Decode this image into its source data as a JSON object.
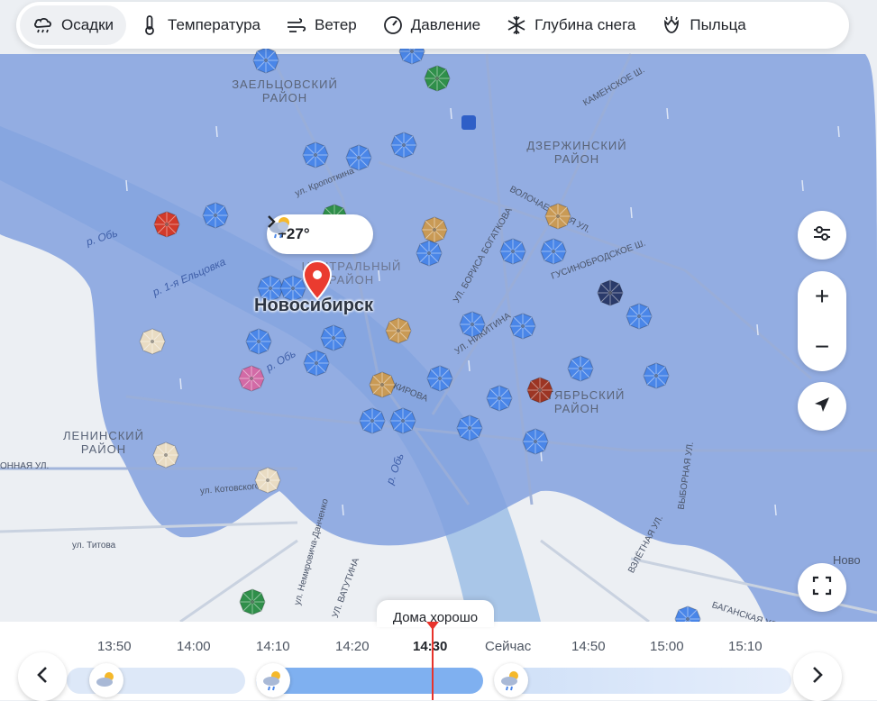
{
  "tabs": [
    {
      "label": "Осадки",
      "icon": "rain-cloud-icon",
      "active": true
    },
    {
      "label": "Температура",
      "icon": "thermometer-icon",
      "active": false
    },
    {
      "label": "Ветер",
      "icon": "wind-icon",
      "active": false
    },
    {
      "label": "Давление",
      "icon": "pressure-gauge-icon",
      "active": false
    },
    {
      "label": "Глубина снега",
      "icon": "snowflake-icon",
      "active": false
    },
    {
      "label": "Пыльца",
      "icon": "pollen-icon",
      "active": false
    }
  ],
  "city": {
    "name": "Новосибирск",
    "temperature": "+27°",
    "weather_icon": "partly-cloudy-rain-icon"
  },
  "map_labels": {
    "districts": [
      "ЗАЕЛЬЦОВСКИЙ\nРАЙОН",
      "ДЗЕРЖИНСКИЙ\nРАЙОН",
      "ЦЕНТРАЛЬНЫЙ\nРАЙОН",
      "ОКТЯБРЬСКИЙ\nРАЙОН",
      "ЛЕНИНСКИЙ\nРАЙОН"
    ],
    "rivers": [
      "р. Обь",
      "р. 1-я Ельцовка",
      "р. Обь",
      "р. Обь"
    ],
    "streets": [
      "ул. Кропоткина",
      "КАМЕНСКОЕ Ш.",
      "ВОЛОЧАЕВСКАЯ УЛ.",
      "ГУСИНОБРОДСКОЕ Ш.",
      "УЛ. БОРИСА БОГАТКОВА",
      "УЛ. НИКИТИНА",
      "УЛ. КИРОВА",
      "ул. Котовского",
      "ул. Титова",
      "ул. Немировича-Данченко",
      "ВЫБОРНАЯ УЛ.",
      "ВЗЛЁТНАЯ УЛ.",
      "БАГАНСКАЯ УЛ.",
      "ОННАЯ УЛ.",
      "УЛ. ВАТУТИНА",
      "Ново"
    ]
  },
  "umbrella_colors": {
    "blue": "#4a86e8",
    "red": "#d23a2a",
    "green": "#2f8f4a",
    "tan": "#c99a55",
    "beige": "#e9dcc3",
    "pink": "#d26aa6",
    "navy": "#2a3a6a",
    "brown": "#9c3524"
  },
  "controls": {
    "filter": "filter-sliders-icon",
    "zoom_in": "+",
    "zoom_out": "−",
    "locate": "locate-arrow-icon",
    "fullscreen": "fullscreen-icon"
  },
  "timeline": {
    "tooltip": "Дома хорошо",
    "ticks": [
      {
        "label": "13:50",
        "bold": false
      },
      {
        "label": "14:00",
        "bold": false
      },
      {
        "label": "14:10",
        "bold": false
      },
      {
        "label": "14:20",
        "bold": false
      },
      {
        "label": "14:30",
        "bold": true
      },
      {
        "label": "Сейчас",
        "bold": false
      },
      {
        "label": "14:50",
        "bold": false
      },
      {
        "label": "15:00",
        "bold": false
      },
      {
        "label": "15:10",
        "bold": false
      }
    ],
    "prev": "chevron-left-icon",
    "next": "chevron-right-icon"
  },
  "colors": {
    "precip_overlay": "#7f9fde",
    "now_marker": "#e8332b",
    "pin": "#ea3b2f"
  }
}
